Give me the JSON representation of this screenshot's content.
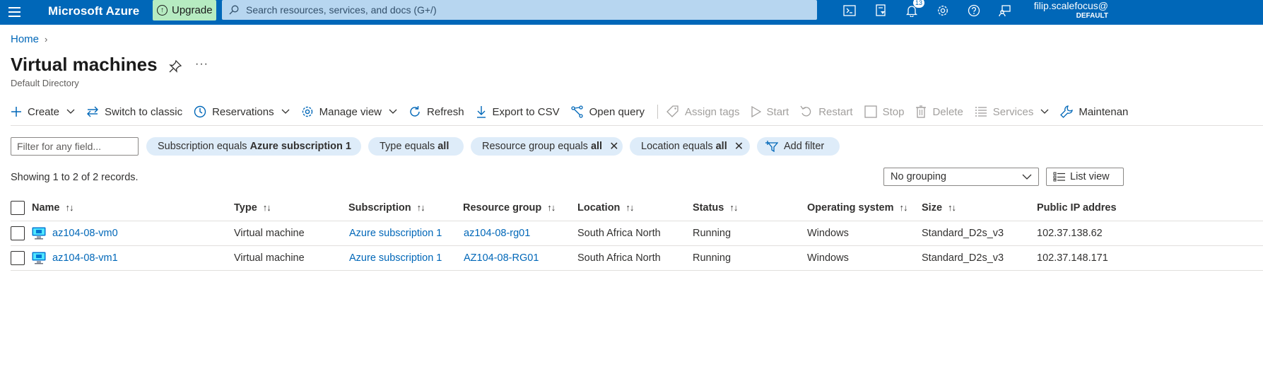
{
  "topbar": {
    "brand": "Microsoft Azure",
    "upgrade_label": "Upgrade",
    "search_placeholder": "Search resources, services, and docs (G+/)",
    "notification_count": "13",
    "account_user": "filip.scalefocus@",
    "account_directory": "DEFAULT"
  },
  "breadcrumb": {
    "home": "Home"
  },
  "page": {
    "title": "Virtual machines",
    "subtitle": "Default Directory",
    "more": "···"
  },
  "commands": {
    "create": "Create",
    "switch_classic": "Switch to classic",
    "reservations": "Reservations",
    "manage_view": "Manage view",
    "refresh": "Refresh",
    "export_csv": "Export to CSV",
    "open_query": "Open query",
    "assign_tags": "Assign tags",
    "start": "Start",
    "restart": "Restart",
    "stop": "Stop",
    "delete": "Delete",
    "services": "Services",
    "maintenance": "Maintenan"
  },
  "filters": {
    "placeholder": "Filter for any field...",
    "subscription_label": "Subscription equals ",
    "subscription_value": "Azure subscription 1",
    "type_label": "Type equals ",
    "type_value": "all",
    "rg_label": "Resource group equals ",
    "rg_value": "all",
    "location_label": "Location equals ",
    "location_value": "all",
    "add_filter": "Add filter"
  },
  "records_text": "Showing 1 to 2 of 2 records.",
  "grouping": "No grouping",
  "list_view": "List view",
  "table": {
    "headers": {
      "name": "Name",
      "type": "Type",
      "subscription": "Subscription",
      "resource_group": "Resource group",
      "location": "Location",
      "status": "Status",
      "os": "Operating system",
      "size": "Size",
      "public_ip": "Public IP addres"
    },
    "rows": [
      {
        "name": "az104-08-vm0",
        "type": "Virtual machine",
        "subscription": "Azure subscription 1",
        "resource_group": "az104-08-rg01",
        "location": "South Africa North",
        "status": "Running",
        "os": "Windows",
        "size": "Standard_D2s_v3",
        "public_ip": "102.37.138.62"
      },
      {
        "name": "az104-08-vm1",
        "type": "Virtual machine",
        "subscription": "Azure subscription 1",
        "resource_group": "AZ104-08-RG01",
        "location": "South Africa North",
        "status": "Running",
        "os": "Windows",
        "size": "Standard_D2s_v3",
        "public_ip": "102.37.148.171"
      }
    ]
  }
}
